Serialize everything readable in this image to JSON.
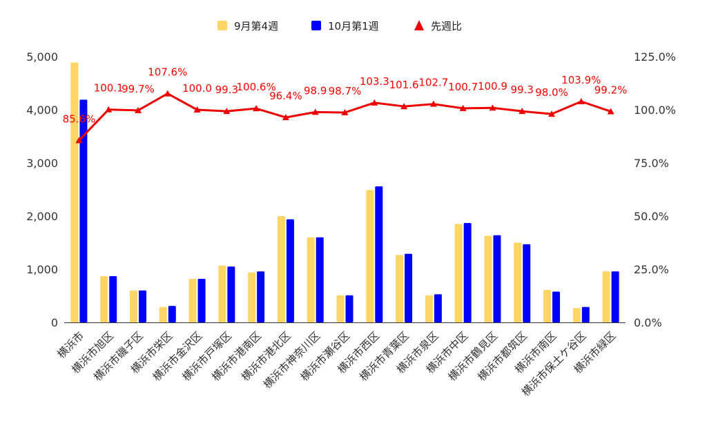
{
  "chart_data": {
    "type": "bar",
    "categories": [
      "横浜市",
      "横浜市旭区",
      "横浜市磯子区",
      "横浜市栄区",
      "横浜市金沢区",
      "横浜市戸塚区",
      "横浜市港南区",
      "横浜市港北区",
      "横浜市神奈川区",
      "横浜市瀬谷区",
      "横浜市西区",
      "横浜市青葉区",
      "横浜市泉区",
      "横浜市中区",
      "横浜市鶴見区",
      "横浜市都筑区",
      "横浜市南区",
      "横浜市保土ケ谷区",
      "横浜市緑区"
    ],
    "series": [
      {
        "name": "9月第4週",
        "type": "bar",
        "axis": "left",
        "color": "#fcd564",
        "values": [
          4890,
          870,
          600,
          290,
          820,
          1070,
          940,
          2000,
          1600,
          510,
          2490,
          1270,
          510,
          1850,
          1630,
          1500,
          610,
          270,
          960
        ]
      },
      {
        "name": "10月第1週",
        "type": "bar",
        "axis": "left",
        "color": "#0000ff",
        "values": [
          4190,
          870,
          600,
          310,
          820,
          1050,
          960,
          1940,
          1600,
          510,
          2560,
          1290,
          530,
          1870,
          1640,
          1470,
          580,
          290,
          960
        ]
      },
      {
        "name": "先週比",
        "type": "line",
        "axis": "right",
        "color": "#ee0000",
        "values": [
          85.6,
          100.1,
          99.7,
          107.6,
          100.0,
          99.3,
          100.6,
          96.4,
          98.9,
          98.7,
          103.3,
          101.6,
          102.7,
          100.7,
          100.9,
          99.3,
          98.0,
          103.9,
          99.2
        ],
        "labels": [
          "85.6%",
          "100.1",
          "99.7%",
          "107.6%",
          "100.0",
          "99.3",
          "100.6%",
          "96.4%",
          "98.9",
          "98.7%",
          "103.3",
          "101.6",
          "102.7",
          "100.7",
          "100.9",
          "99.3",
          "98.0%",
          "103.9%",
          "99.2%"
        ]
      }
    ],
    "y_left": {
      "range": [
        0,
        5000
      ],
      "ticks": [
        "0",
        "1,000",
        "2,000",
        "3,000",
        "4,000",
        "5,000"
      ]
    },
    "y_right": {
      "range": [
        0,
        125
      ],
      "ticks": [
        "0.0%",
        "25.0%",
        "50.0%",
        "75.0%",
        "100.0%",
        "125.0%"
      ]
    },
    "grid": false,
    "legend_position": "top"
  }
}
